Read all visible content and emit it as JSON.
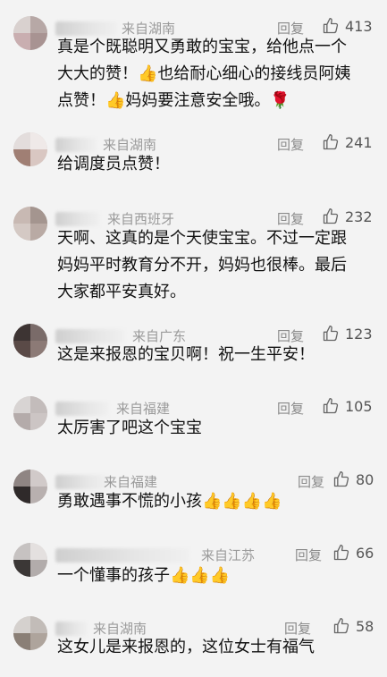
{
  "comments": [
    {
      "from": "来自湖南",
      "reply": "回复",
      "likes": "413",
      "lines": [
        "真是个既聪明又勇敢的宝宝，给他点一个",
        "大大的赞！👍也给耐心细心的接线员阿姨",
        "点赞！👍妈妈要注意安全哦。🌹"
      ]
    },
    {
      "from": "来自湖南",
      "reply": "回复",
      "likes": "241",
      "lines": [
        "给调度员点赞！"
      ]
    },
    {
      "from": "来自西班牙",
      "reply": "回复",
      "likes": "232",
      "lines": [
        "天啊、这真的是个天使宝宝。不过一定跟",
        "妈妈平时教育分不开，妈妈也很棒。最后",
        "大家都平安真好。"
      ]
    },
    {
      "from": "来自广东",
      "reply": "回复",
      "likes": "123",
      "lines": [
        "这是来报恩的宝贝啊！祝一生平安！"
      ]
    },
    {
      "from": "来自福建",
      "reply": "回复",
      "likes": "105",
      "lines": [
        "太厉害了吧这个宝宝"
      ]
    },
    {
      "from": "来自福建",
      "reply": "回复",
      "likes": "80",
      "lines": [
        "勇敢遇事不慌的小孩👍👍👍👍"
      ]
    },
    {
      "from": "来自江苏",
      "reply": "回复",
      "likes": "66",
      "lines": [
        "一个懂事的孩子👍👍👍"
      ]
    },
    {
      "from": "来自湖南",
      "reply": "回复",
      "likes": "58",
      "lines": [
        "这女儿是来报恩的，这位女士有福气"
      ]
    }
  ]
}
